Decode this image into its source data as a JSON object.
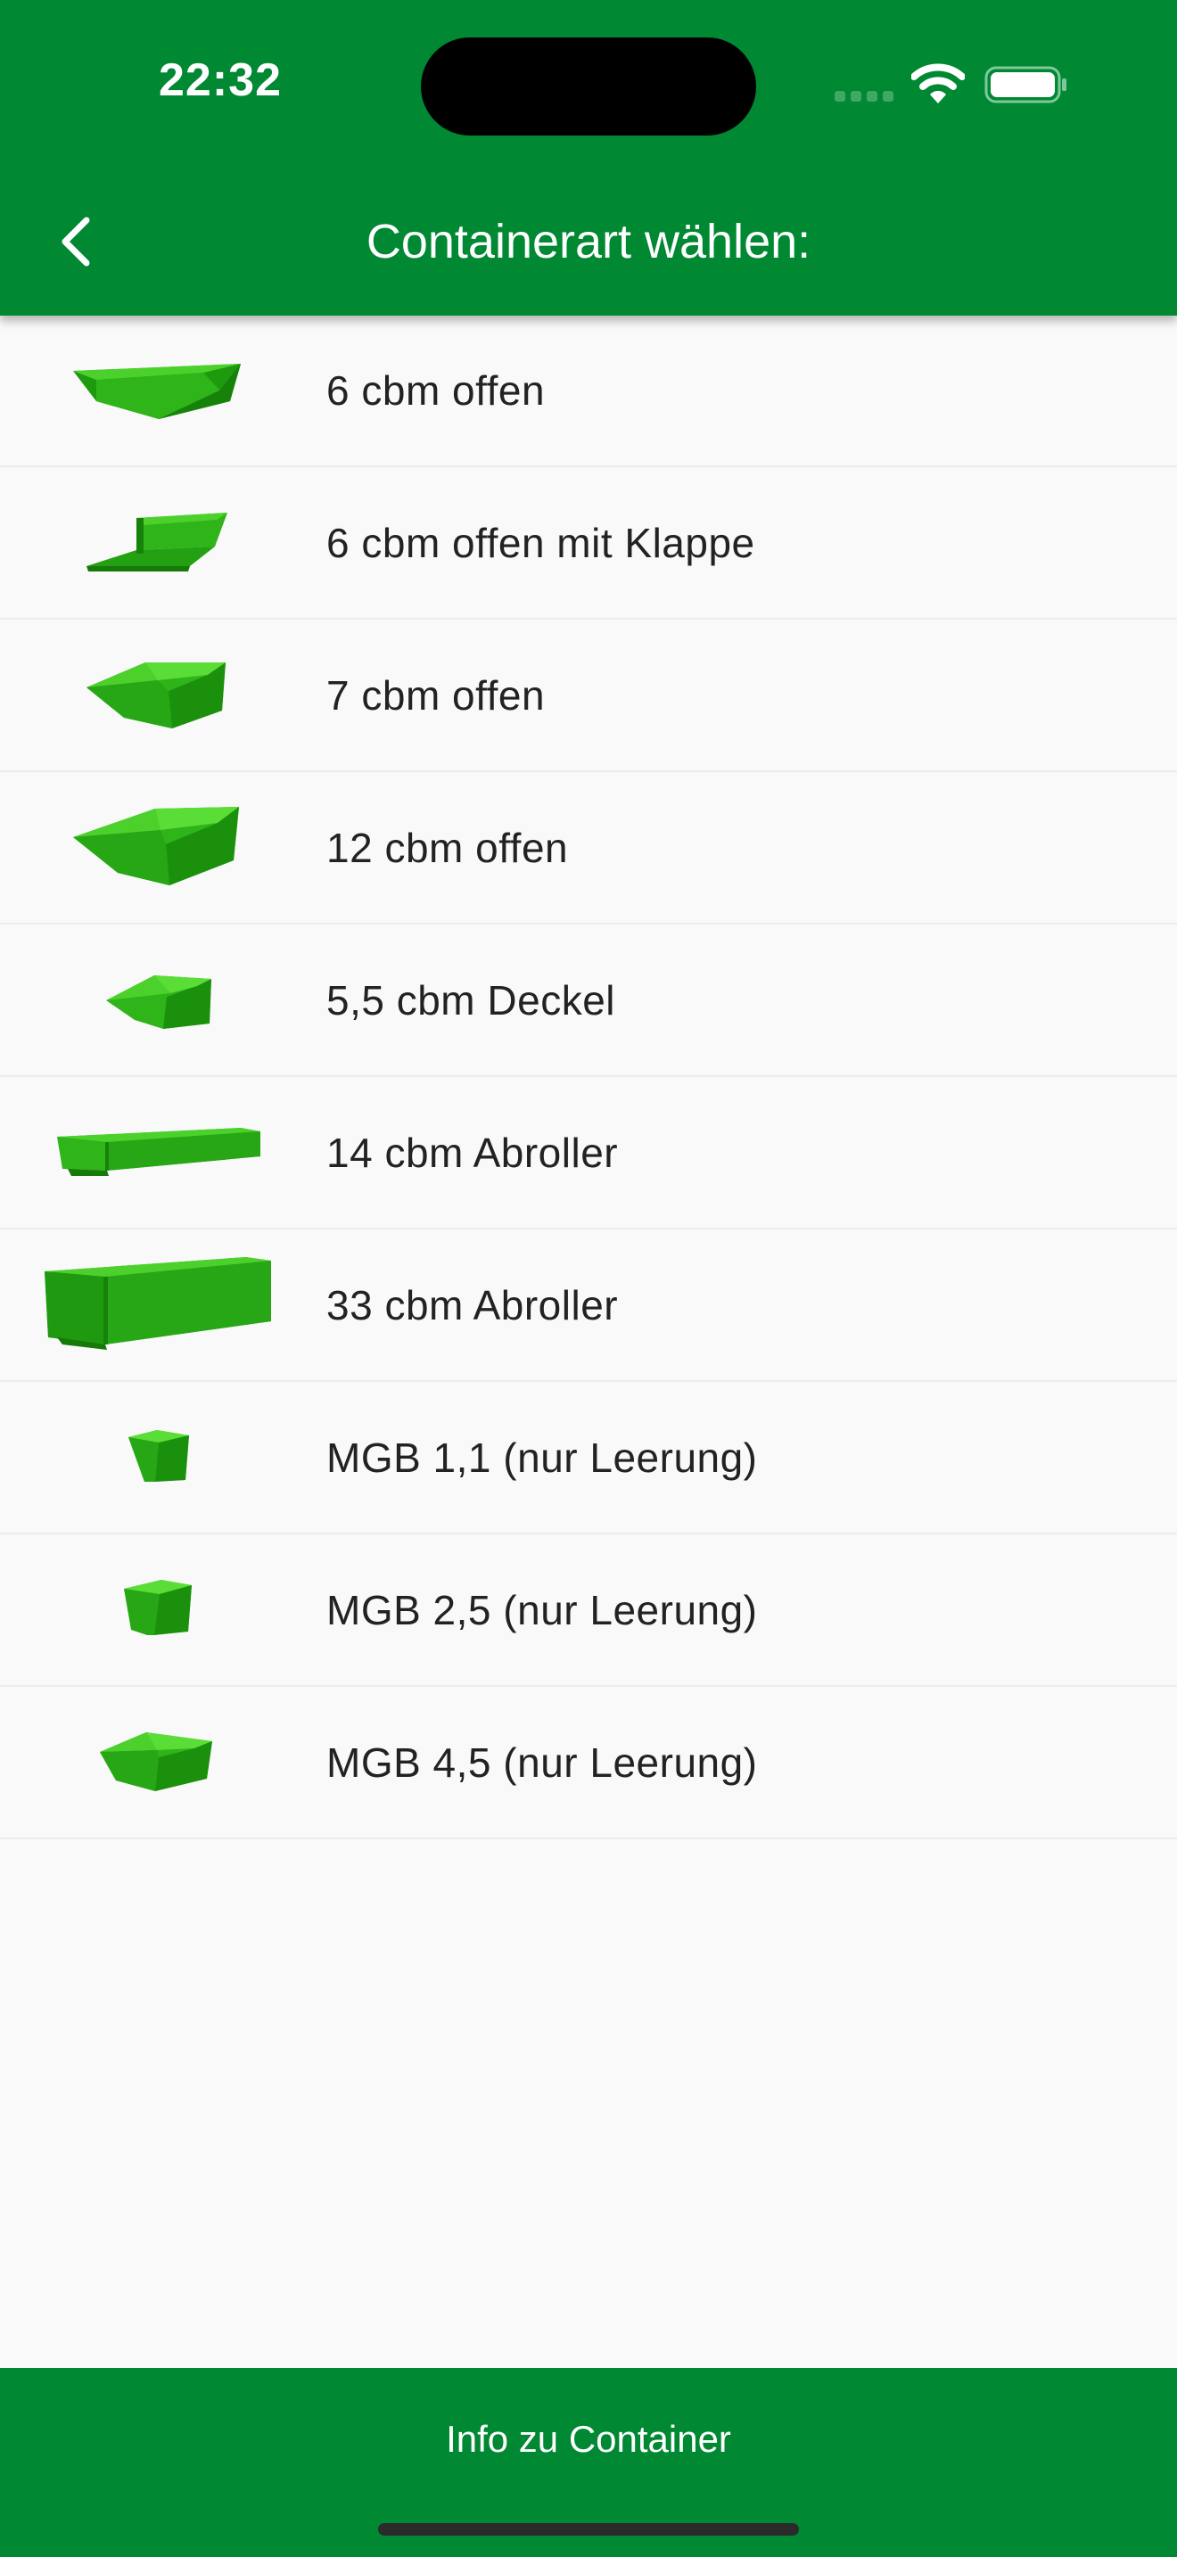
{
  "status_bar": {
    "time": "22:32"
  },
  "header": {
    "title": "Containerart wählen:"
  },
  "containers": [
    {
      "label": "6 cbm offen",
      "icon": "skip-container-icon"
    },
    {
      "label": "6 cbm offen mit Klappe",
      "icon": "skip-container-flap-icon"
    },
    {
      "label": "7 cbm offen",
      "icon": "skip-container-icon"
    },
    {
      "label": "12 cbm offen",
      "icon": "skip-container-icon"
    },
    {
      "label": "5,5 cbm Deckel",
      "icon": "lidded-container-icon"
    },
    {
      "label": "14 cbm Abroller",
      "icon": "roll-off-container-icon"
    },
    {
      "label": "33 cbm Abroller",
      "icon": "roll-off-container-icon"
    },
    {
      "label": "MGB 1,1 (nur Leerung)",
      "icon": "waste-bin-icon"
    },
    {
      "label": "MGB 2,5 (nur Leerung)",
      "icon": "waste-bin-icon"
    },
    {
      "label": "MGB 4,5 (nur Leerung)",
      "icon": "waste-bin-icon"
    }
  ],
  "bottom_bar": {
    "info_label": "Info zu Container"
  },
  "colors": {
    "brand_green": "#008833",
    "container_green": "#22aa11",
    "background": "#f9f9f9"
  }
}
